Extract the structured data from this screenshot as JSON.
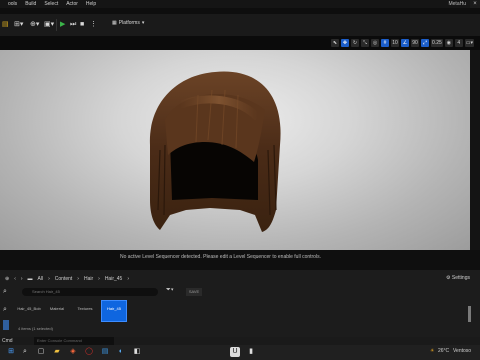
{
  "menubar": {
    "items": [
      "ools",
      "Build",
      "Select",
      "Actor",
      "Help"
    ],
    "project": "MetaHu",
    "close": "×"
  },
  "toolbar": {
    "platforms": "Platforms"
  },
  "viewport_toolbar": {
    "fov": "90",
    "snap_value": "0.25",
    "count": "4",
    "grid": "10"
  },
  "sequencer_notice": "No active Level Sequencer detected. Please edit a Level Sequencer to enable full controls.",
  "content_browser": {
    "breadcrumb": [
      "All",
      "Content",
      "Hair",
      "Hair_45"
    ],
    "settings_label": "Settings",
    "search_placeholder": "Search Hair_45",
    "save_label": "SAVE",
    "assets": [
      {
        "label": "Hair_45_Bob",
        "selected": false
      },
      {
        "label": "Material",
        "selected": false
      },
      {
        "label": "Textures",
        "selected": false
      },
      {
        "label": "Hair_45",
        "selected": true
      }
    ],
    "count_text": "4 items (1 selected)"
  },
  "cmd": {
    "console_label": "Cmd",
    "placeholder": "Enter Console Command"
  },
  "taskbar": {
    "weather_temp": "26°C",
    "weather_label": "Ventoso"
  },
  "colors": {
    "accent": "#1c5ec9",
    "selected_asset": "#0f66e0",
    "play_green": "#3bb54a"
  }
}
